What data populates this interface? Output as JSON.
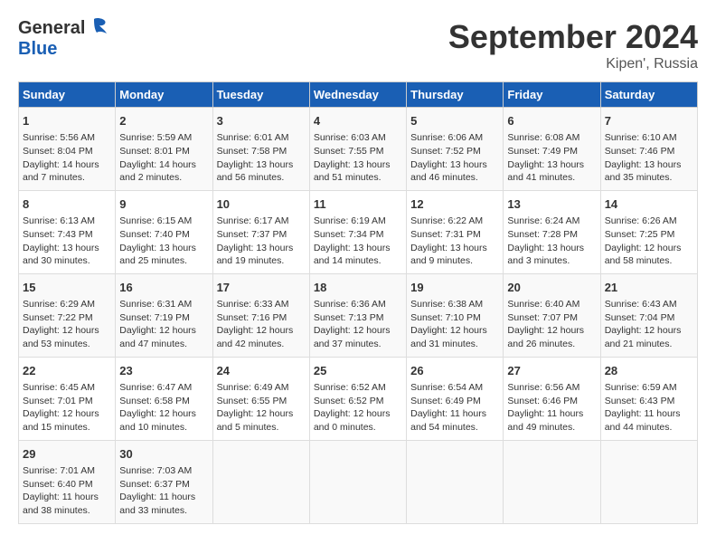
{
  "header": {
    "logo_general": "General",
    "logo_blue": "Blue",
    "title": "September 2024",
    "subtitle": "Kipen', Russia"
  },
  "days_of_week": [
    "Sunday",
    "Monday",
    "Tuesday",
    "Wednesday",
    "Thursday",
    "Friday",
    "Saturday"
  ],
  "weeks": [
    [
      {
        "day": "1",
        "sunrise": "5:56 AM",
        "sunset": "8:04 PM",
        "daylight": "14 hours and 7 minutes."
      },
      {
        "day": "2",
        "sunrise": "5:59 AM",
        "sunset": "8:01 PM",
        "daylight": "14 hours and 2 minutes."
      },
      {
        "day": "3",
        "sunrise": "6:01 AM",
        "sunset": "7:58 PM",
        "daylight": "13 hours and 56 minutes."
      },
      {
        "day": "4",
        "sunrise": "6:03 AM",
        "sunset": "7:55 PM",
        "daylight": "13 hours and 51 minutes."
      },
      {
        "day": "5",
        "sunrise": "6:06 AM",
        "sunset": "7:52 PM",
        "daylight": "13 hours and 46 minutes."
      },
      {
        "day": "6",
        "sunrise": "6:08 AM",
        "sunset": "7:49 PM",
        "daylight": "13 hours and 41 minutes."
      },
      {
        "day": "7",
        "sunrise": "6:10 AM",
        "sunset": "7:46 PM",
        "daylight": "13 hours and 35 minutes."
      }
    ],
    [
      {
        "day": "8",
        "sunrise": "6:13 AM",
        "sunset": "7:43 PM",
        "daylight": "13 hours and 30 minutes."
      },
      {
        "day": "9",
        "sunrise": "6:15 AM",
        "sunset": "7:40 PM",
        "daylight": "13 hours and 25 minutes."
      },
      {
        "day": "10",
        "sunrise": "6:17 AM",
        "sunset": "7:37 PM",
        "daylight": "13 hours and 19 minutes."
      },
      {
        "day": "11",
        "sunrise": "6:19 AM",
        "sunset": "7:34 PM",
        "daylight": "13 hours and 14 minutes."
      },
      {
        "day": "12",
        "sunrise": "6:22 AM",
        "sunset": "7:31 PM",
        "daylight": "13 hours and 9 minutes."
      },
      {
        "day": "13",
        "sunrise": "6:24 AM",
        "sunset": "7:28 PM",
        "daylight": "13 hours and 3 minutes."
      },
      {
        "day": "14",
        "sunrise": "6:26 AM",
        "sunset": "7:25 PM",
        "daylight": "12 hours and 58 minutes."
      }
    ],
    [
      {
        "day": "15",
        "sunrise": "6:29 AM",
        "sunset": "7:22 PM",
        "daylight": "12 hours and 53 minutes."
      },
      {
        "day": "16",
        "sunrise": "6:31 AM",
        "sunset": "7:19 PM",
        "daylight": "12 hours and 47 minutes."
      },
      {
        "day": "17",
        "sunrise": "6:33 AM",
        "sunset": "7:16 PM",
        "daylight": "12 hours and 42 minutes."
      },
      {
        "day": "18",
        "sunrise": "6:36 AM",
        "sunset": "7:13 PM",
        "daylight": "12 hours and 37 minutes."
      },
      {
        "day": "19",
        "sunrise": "6:38 AM",
        "sunset": "7:10 PM",
        "daylight": "12 hours and 31 minutes."
      },
      {
        "day": "20",
        "sunrise": "6:40 AM",
        "sunset": "7:07 PM",
        "daylight": "12 hours and 26 minutes."
      },
      {
        "day": "21",
        "sunrise": "6:43 AM",
        "sunset": "7:04 PM",
        "daylight": "12 hours and 21 minutes."
      }
    ],
    [
      {
        "day": "22",
        "sunrise": "6:45 AM",
        "sunset": "7:01 PM",
        "daylight": "12 hours and 15 minutes."
      },
      {
        "day": "23",
        "sunrise": "6:47 AM",
        "sunset": "6:58 PM",
        "daylight": "12 hours and 10 minutes."
      },
      {
        "day": "24",
        "sunrise": "6:49 AM",
        "sunset": "6:55 PM",
        "daylight": "12 hours and 5 minutes."
      },
      {
        "day": "25",
        "sunrise": "6:52 AM",
        "sunset": "6:52 PM",
        "daylight": "12 hours and 0 minutes."
      },
      {
        "day": "26",
        "sunrise": "6:54 AM",
        "sunset": "6:49 PM",
        "daylight": "11 hours and 54 minutes."
      },
      {
        "day": "27",
        "sunrise": "6:56 AM",
        "sunset": "6:46 PM",
        "daylight": "11 hours and 49 minutes."
      },
      {
        "day": "28",
        "sunrise": "6:59 AM",
        "sunset": "6:43 PM",
        "daylight": "11 hours and 44 minutes."
      }
    ],
    [
      {
        "day": "29",
        "sunrise": "7:01 AM",
        "sunset": "6:40 PM",
        "daylight": "11 hours and 38 minutes."
      },
      {
        "day": "30",
        "sunrise": "7:03 AM",
        "sunset": "6:37 PM",
        "daylight": "11 hours and 33 minutes."
      },
      null,
      null,
      null,
      null,
      null
    ]
  ],
  "labels": {
    "sunrise": "Sunrise:",
    "sunset": "Sunset:",
    "daylight": "Daylight hours"
  }
}
